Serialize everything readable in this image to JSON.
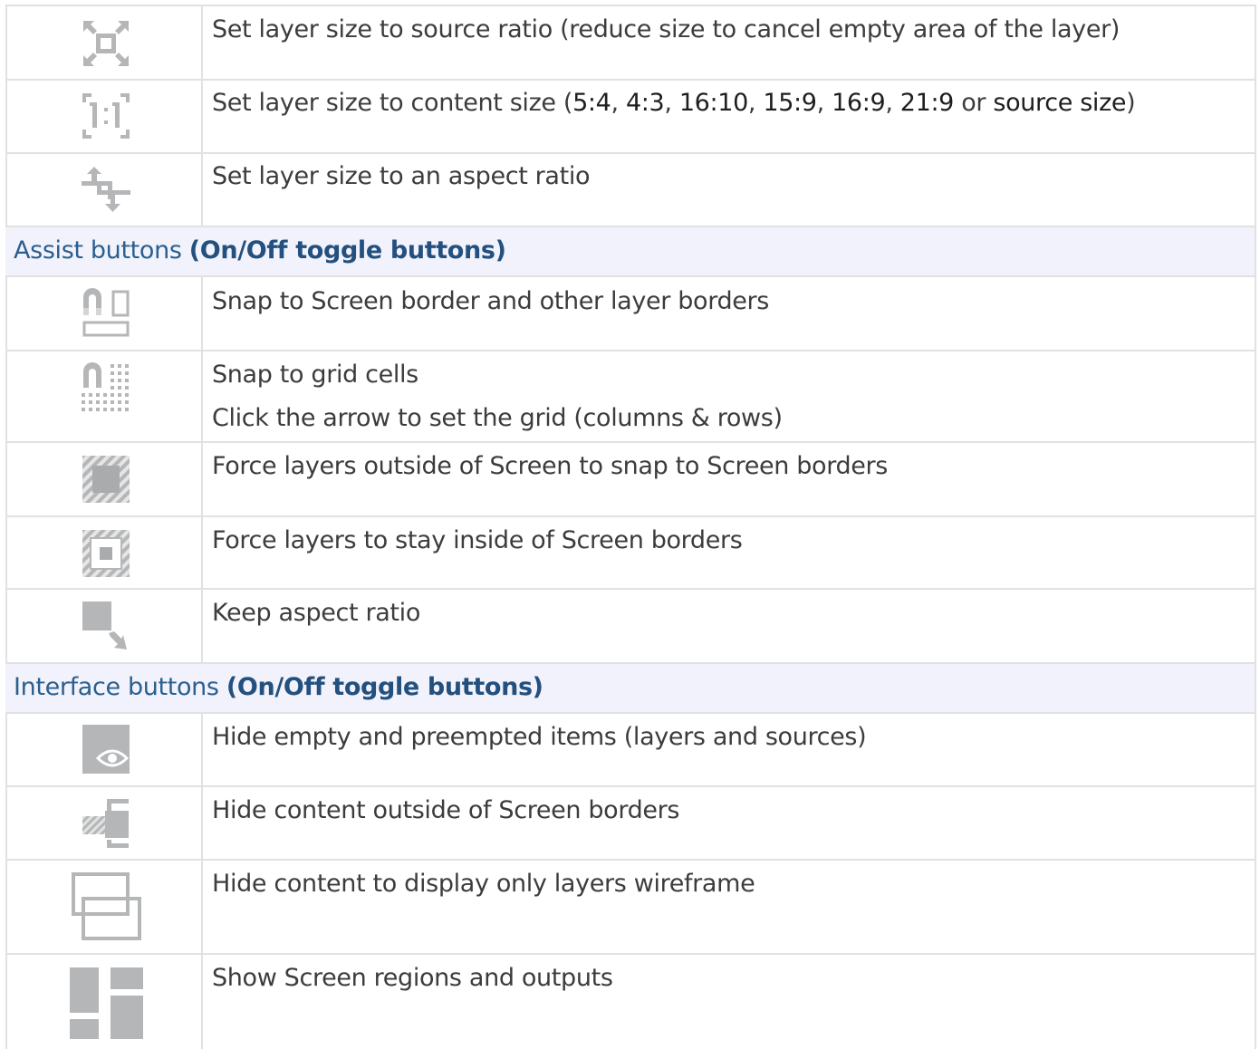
{
  "rows_top": [
    {
      "icon": "fit-source-ratio-icon",
      "text": "Set layer size to source ratio (reduce size to cancel empty area of the layer)"
    },
    {
      "icon": "content-size-icon",
      "text_parts": [
        "Set layer size to content size (",
        "5:4",
        ", ",
        "4:3",
        ", ",
        "16:10",
        ", ",
        "15:9",
        ", ",
        "16:9",
        ", ",
        "21:9",
        " or ",
        "source size",
        ")"
      ]
    },
    {
      "icon": "aspect-ratio-crop-icon",
      "text": "Set layer size to an aspect ratio"
    }
  ],
  "section_assist": {
    "label": "Assist buttons ",
    "bold": "(On/Off toggle buttons)"
  },
  "rows_assist": [
    {
      "icon": "snap-borders-icon",
      "text": "Snap to Screen border and other layer borders"
    },
    {
      "icon": "snap-grid-icon",
      "text": "Snap to grid cells",
      "text2": "Click the arrow to set the grid (columns & rows)"
    },
    {
      "icon": "force-outside-snap-icon",
      "text": "Force layers outside of Screen to snap to Screen borders"
    },
    {
      "icon": "force-inside-icon",
      "text": "Force layers to stay inside of Screen borders"
    },
    {
      "icon": "keep-aspect-ratio-icon",
      "text": "Keep aspect ratio"
    }
  ],
  "section_interface": {
    "label": "Interface buttons ",
    "bold": "(On/Off toggle buttons)"
  },
  "rows_interface": [
    {
      "icon": "hide-empty-eye-icon",
      "text": "Hide empty and preempted items (layers and sources)"
    },
    {
      "icon": "hide-outside-icon",
      "text": "Hide content outside of Screen borders"
    },
    {
      "icon": "wireframe-icon",
      "text": "Hide content to display only layers wireframe"
    },
    {
      "icon": "screen-regions-icon",
      "text": "Show Screen regions and outputs"
    }
  ],
  "colors": {
    "border": "#e1e1e1",
    "section_bg": "#f1f2fb",
    "section_text": "#2a5f8e",
    "icon_gray": "#b4b6b8"
  }
}
